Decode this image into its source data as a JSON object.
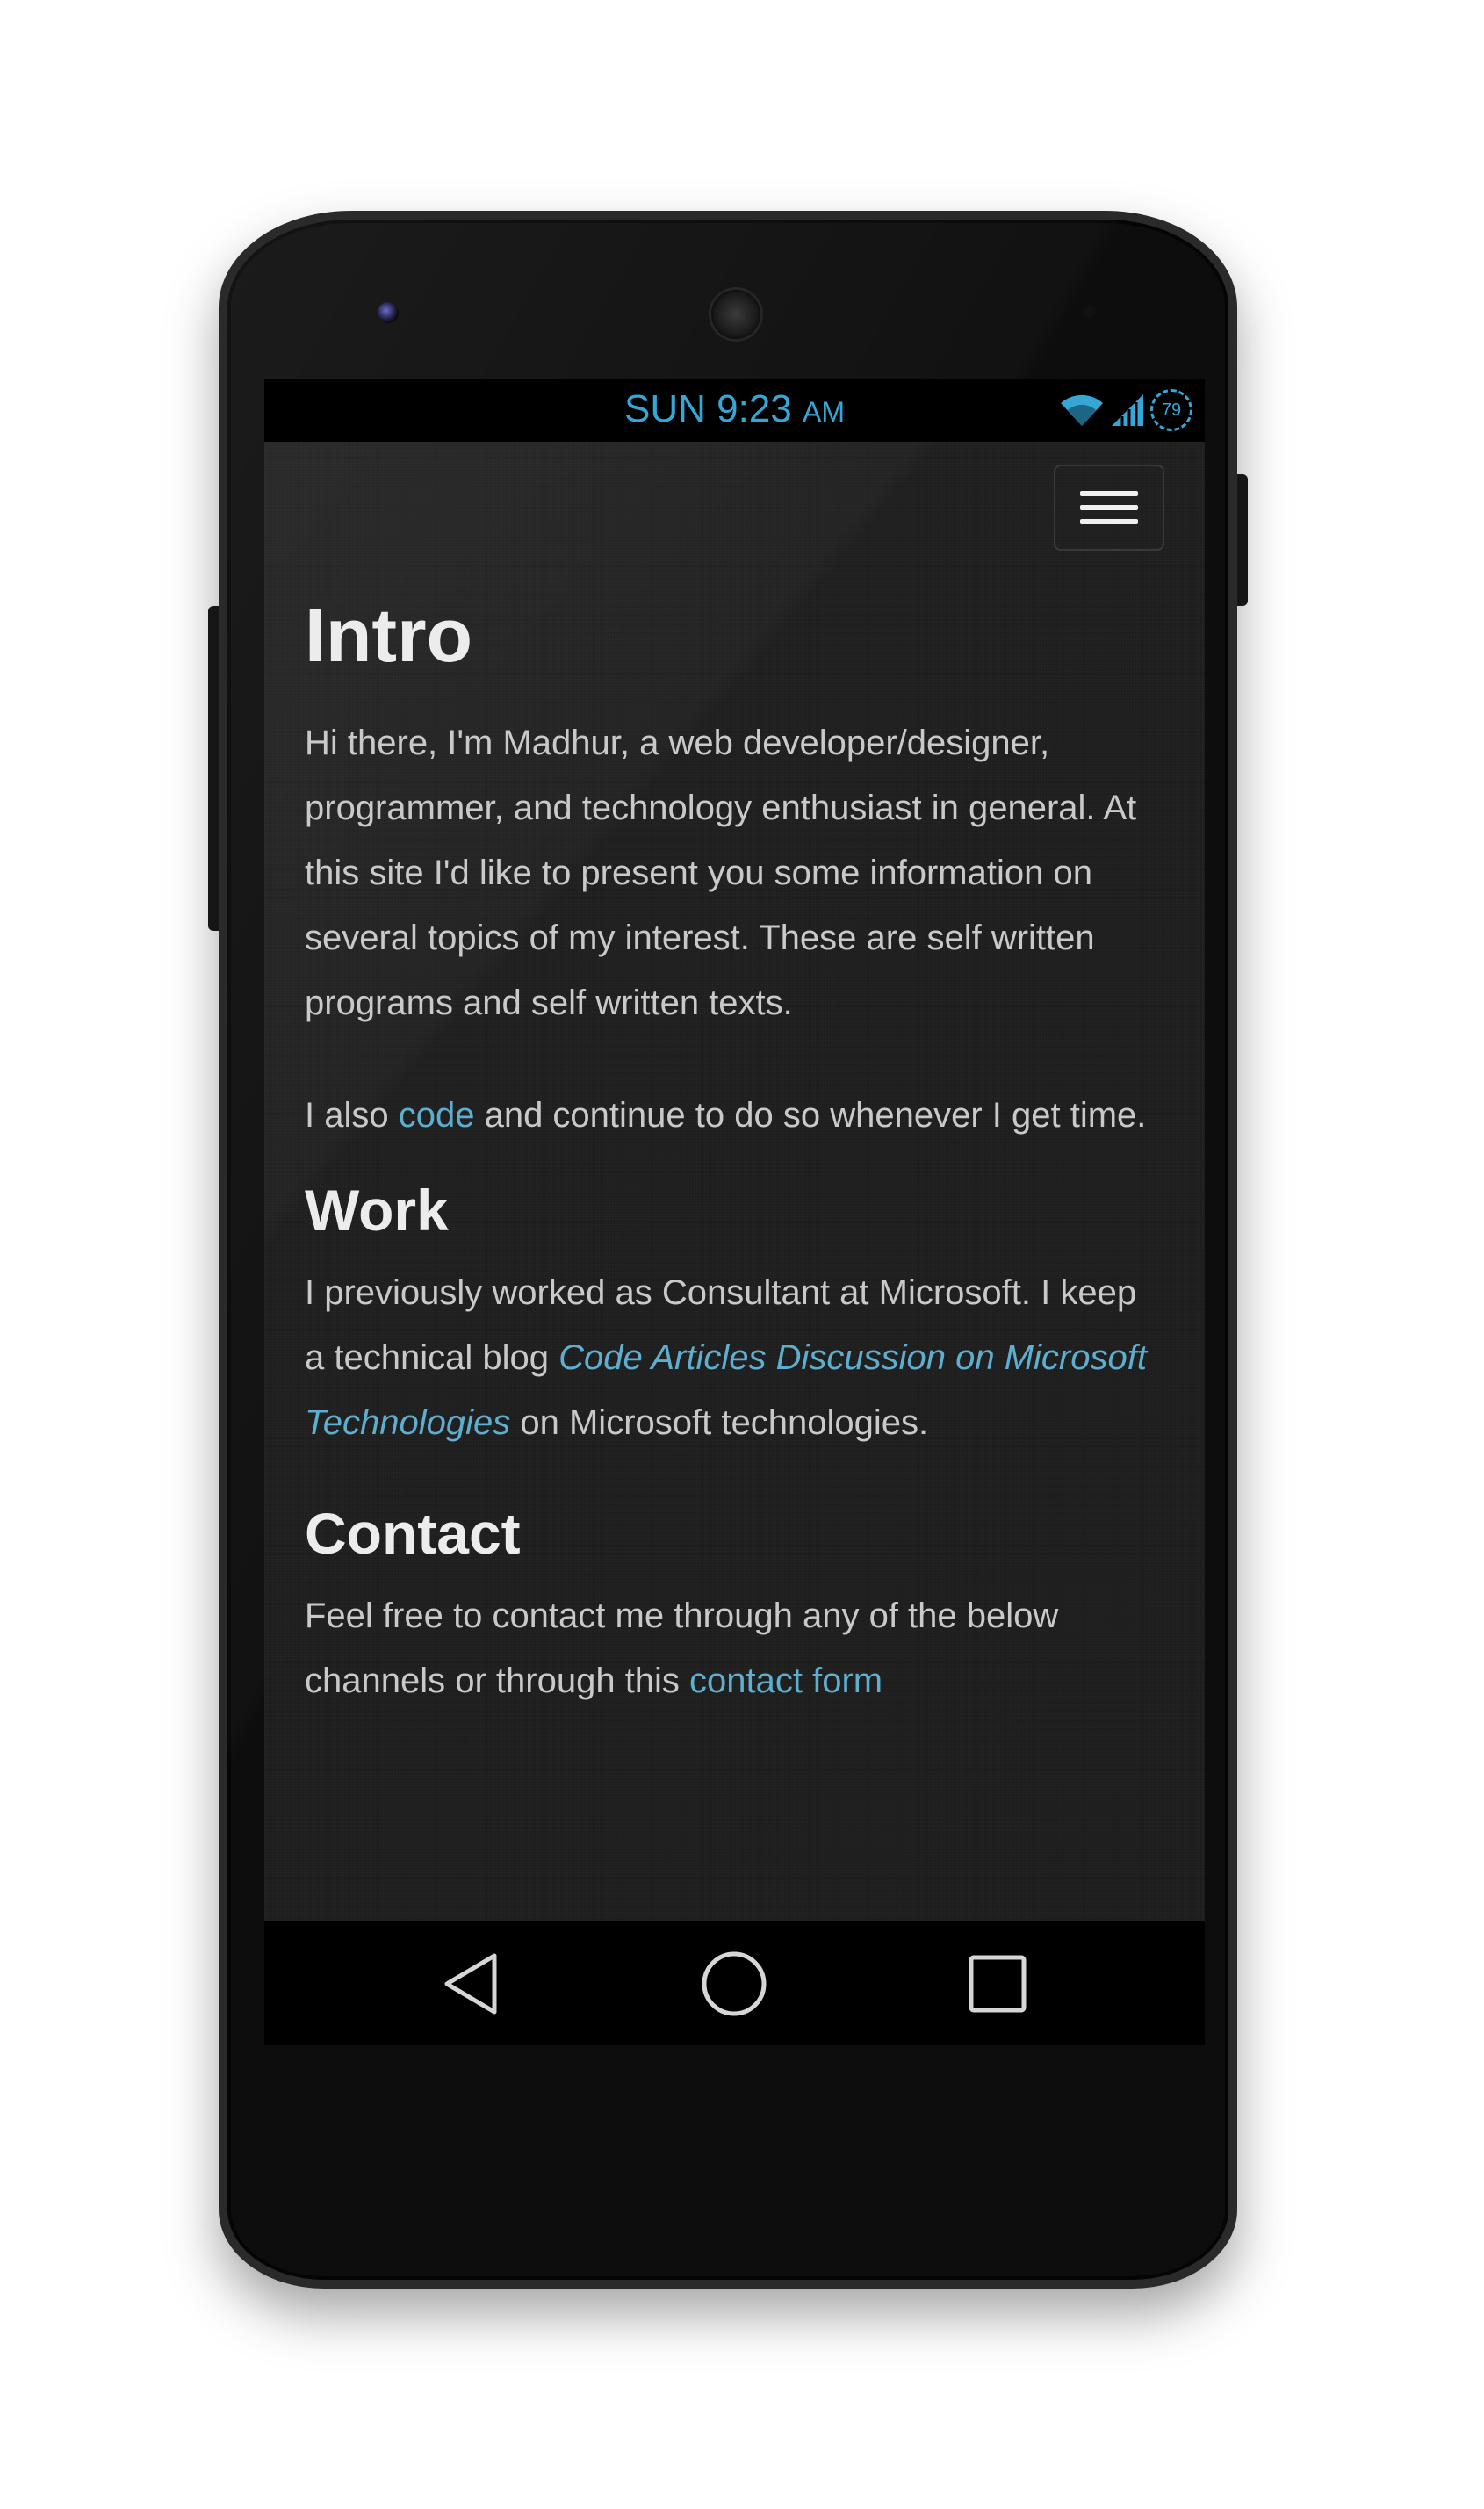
{
  "status_bar": {
    "day": "SUN",
    "time": "9:23",
    "ampm": "AM",
    "battery": "79",
    "accent_color": "#35a6d6"
  },
  "header": {
    "menu_icon": "hamburger-menu-icon"
  },
  "intro": {
    "title": "Intro",
    "paragraph1": "Hi there, I'm Madhur, a web developer/designer, programmer, and technology enthusiast in general. At this site I'd like to present you some information on several topics of my interest. These are self written programs and self written texts.",
    "paragraph2_before": "I also ",
    "paragraph2_link": "code",
    "paragraph2_after": " and continue to do so whenever I get time."
  },
  "work": {
    "title": "Work",
    "text_before": "I previously worked as Consultant at Microsoft. I keep a technical blog ",
    "blog_link": "Code Articles Discussion on Microsoft Technologies",
    "text_after": " on Microsoft technologies."
  },
  "contact": {
    "title": "Contact",
    "text_before": "Feel free to contact me through any of the below channels or through this ",
    "form_link": "contact form"
  },
  "nav_bar": {
    "back": "back-icon",
    "home": "home-icon",
    "recents": "recents-icon"
  },
  "colors": {
    "link": "#5eaecf",
    "text": "#c9c9c9",
    "heading": "#ececec"
  }
}
